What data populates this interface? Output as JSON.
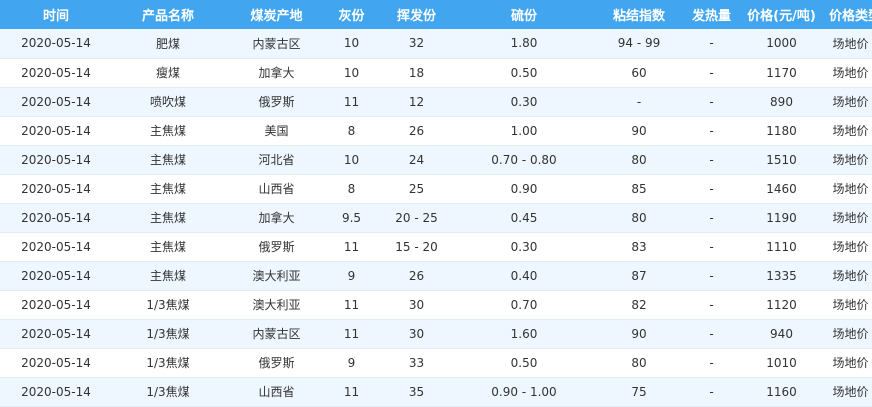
{
  "table": {
    "headers": [
      "时间",
      "产品名称",
      "煤炭产地",
      "灰份",
      "挥发份",
      "硫份",
      "粘结指数",
      "发热量",
      "价格(元/吨)",
      "价格类型"
    ],
    "rows": [
      [
        "2020-05-14",
        "肥煤",
        "内蒙古区",
        "10",
        "32",
        "1.80",
        "94 - 99",
        "-",
        "1000",
        "场地价"
      ],
      [
        "2020-05-14",
        "瘦煤",
        "加拿大",
        "10",
        "18",
        "0.50",
        "60",
        "-",
        "1170",
        "场地价"
      ],
      [
        "2020-05-14",
        "喷吹煤",
        "俄罗斯",
        "11",
        "12",
        "0.30",
        "-",
        "-",
        "890",
        "场地价"
      ],
      [
        "2020-05-14",
        "主焦煤",
        "美国",
        "8",
        "26",
        "1.00",
        "90",
        "-",
        "1180",
        "场地价"
      ],
      [
        "2020-05-14",
        "主焦煤",
        "河北省",
        "10",
        "24",
        "0.70 - 0.80",
        "80",
        "-",
        "1510",
        "场地价"
      ],
      [
        "2020-05-14",
        "主焦煤",
        "山西省",
        "8",
        "25",
        "0.90",
        "85",
        "-",
        "1460",
        "场地价"
      ],
      [
        "2020-05-14",
        "主焦煤",
        "加拿大",
        "9.5",
        "20 - 25",
        "0.45",
        "80",
        "-",
        "1190",
        "场地价"
      ],
      [
        "2020-05-14",
        "主焦煤",
        "俄罗斯",
        "11",
        "15 - 20",
        "0.30",
        "83",
        "-",
        "1110",
        "场地价"
      ],
      [
        "2020-05-14",
        "主焦煤",
        "澳大利亚",
        "9",
        "26",
        "0.40",
        "87",
        "-",
        "1335",
        "场地价"
      ],
      [
        "2020-05-14",
        "1/3焦煤",
        "澳大利亚",
        "11",
        "30",
        "0.70",
        "82",
        "-",
        "1120",
        "场地价"
      ],
      [
        "2020-05-14",
        "1/3焦煤",
        "内蒙古区",
        "11",
        "30",
        "1.60",
        "90",
        "-",
        "940",
        "场地价"
      ],
      [
        "2020-05-14",
        "1/3焦煤",
        "俄罗斯",
        "9",
        "33",
        "0.50",
        "80",
        "-",
        "1010",
        "场地价"
      ],
      [
        "2020-05-14",
        "1/3焦煤",
        "山西省",
        "11",
        "35",
        "0.90 - 1.00",
        "75",
        "-",
        "1160",
        "场地价"
      ]
    ]
  },
  "colors": {
    "header_bg": "#41a6ef",
    "header_text": "#ffffff",
    "row_odd_bg": "#eef7ff",
    "row_even_bg": "#ffffff",
    "cell_text": "#333333"
  }
}
